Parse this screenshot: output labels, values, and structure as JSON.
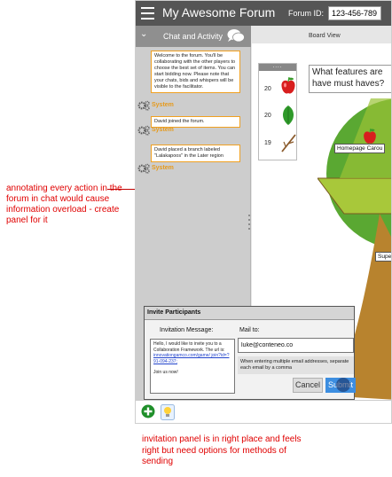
{
  "annotations": {
    "left": "annotating every action in the forum in chat would cause information overload - create panel for it",
    "bottom": "invitation panel is in right place and feels right but need options for methods of sending"
  },
  "header": {
    "title": "My Awesome Forum",
    "forum_id_label": "Forum ID:",
    "forum_id_value": "123-456-789"
  },
  "chat": {
    "title": "Chat and Activity",
    "messages": [
      {
        "text": "Welcome to the forum. You'll be collaborating with the other players to choose the best set of items. You can start bidding now. Please note that your chats, bids and whispers will be visible to the facilitator.",
        "sender": "System"
      },
      {
        "text": "David joined the forum.",
        "sender": "System"
      },
      {
        "text": "David placed a branch labeled \"Lalakapoos\" in the Later region",
        "sender": "System"
      }
    ]
  },
  "board": {
    "label": "Board View",
    "question": "What features are have must haves?",
    "tray_header": "....",
    "tray_items": [
      {
        "count": "20",
        "icon": "apple-icon"
      },
      {
        "count": "20",
        "icon": "leaf-icon"
      },
      {
        "count": "19",
        "icon": "branch-icon"
      }
    ],
    "tree_labels": [
      "Homepage Carou",
      "Supe"
    ]
  },
  "invite": {
    "title": "Invite Participants",
    "message_label": "Invitation Message:",
    "message_line1": "Hello, I would like to invite you to a Collaboration Framework. The url is:",
    "message_url": "innovationgamco.com/game/ join?id=?91-094-237;",
    "message_line2": "Join us now!",
    "mail_label": "Mail to:",
    "mail_value": "luke@conteneo.co",
    "mail_hint": "When entering multiple email addresses, separate each email by a comma",
    "cancel_label": "Cancel",
    "submit_label": "Submit"
  },
  "colors": {
    "topbar": "#555555",
    "chat_header": "#8f8f8f",
    "message_border": "#f0a020",
    "sender_name": "#e69a1c",
    "submit": "#3d8ee0",
    "annotation": "#e00000"
  }
}
